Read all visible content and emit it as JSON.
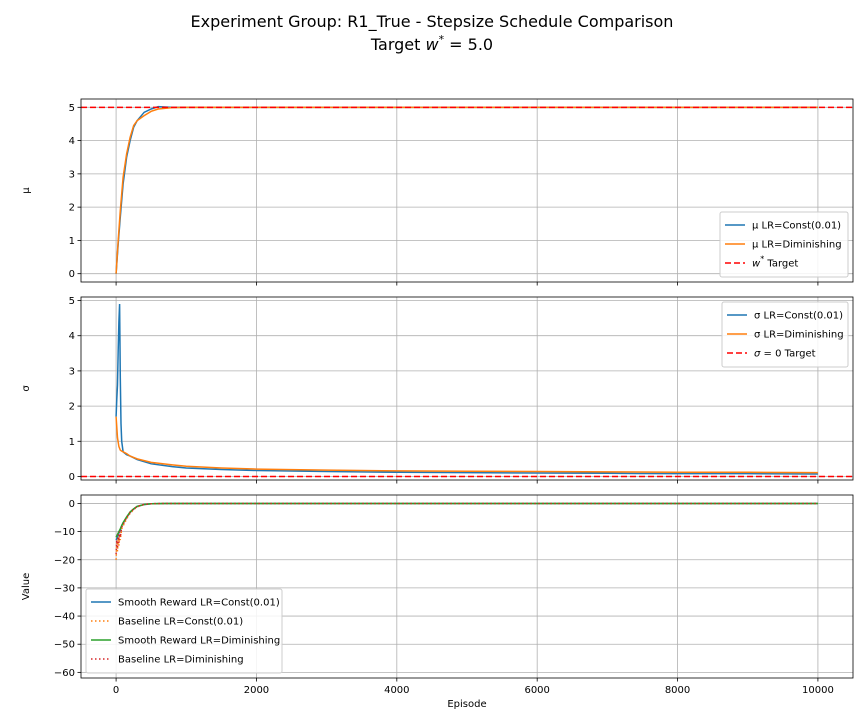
{
  "figure": {
    "title_line1": "Experiment Group: R1_True - Stepsize Schedule Comparison",
    "title_line2_prefix": "Target ",
    "title_line2_symbol": "w",
    "title_line2_sup": "*",
    "title_line2_suffix": " = 5.0"
  },
  "colors": {
    "blue": "#1f77b4",
    "orange": "#ff7f0e",
    "green": "#2ca02c",
    "red": "#d62728",
    "target_red": "#ff0000",
    "grid": "#b0b0b0"
  },
  "chart_data": [
    {
      "type": "line",
      "ylabel": "μ",
      "xlim": [
        -500,
        10500
      ],
      "ylim": [
        -0.25,
        5.25
      ],
      "yticks": [
        0,
        1,
        2,
        3,
        4,
        5
      ],
      "grid": true,
      "legend_position": "lower-right",
      "series": [
        {
          "name": "μ LR=Const(0.01)",
          "color": "blue",
          "style": "solid",
          "x": [
            0,
            30,
            60,
            100,
            150,
            200,
            250,
            300,
            400,
            500,
            600,
            800,
            1000,
            1500,
            2000,
            3000,
            4000,
            5000,
            6000,
            7000,
            8000,
            9000,
            10000
          ],
          "y": [
            0.0,
            0.9,
            1.7,
            2.7,
            3.5,
            4.0,
            4.4,
            4.6,
            4.85,
            4.95,
            5.02,
            5.0,
            5.0,
            5.0,
            5.0,
            5.0,
            5.0,
            5.0,
            5.0,
            5.0,
            5.0,
            5.0,
            5.0
          ]
        },
        {
          "name": "μ LR=Diminishing",
          "color": "orange",
          "style": "solid",
          "x": [
            0,
            30,
            60,
            100,
            150,
            200,
            250,
            300,
            400,
            500,
            600,
            800,
            1000,
            1500,
            2000,
            3000,
            4000,
            5000,
            6000,
            7000,
            8000,
            9000,
            10000
          ],
          "y": [
            0.0,
            1.0,
            1.9,
            2.9,
            3.6,
            4.1,
            4.45,
            4.6,
            4.75,
            4.88,
            4.95,
            4.99,
            5.0,
            5.0,
            5.0,
            5.0,
            5.0,
            5.0,
            5.0,
            5.0,
            5.0,
            5.0,
            5.0
          ]
        },
        {
          "name": "Target",
          "legend_math": "w*",
          "color": "target_red",
          "style": "dashed",
          "hline": 5.0
        }
      ]
    },
    {
      "type": "line",
      "ylabel": "σ",
      "xlim": [
        -500,
        10500
      ],
      "ylim": [
        -0.1,
        5.1
      ],
      "yticks": [
        0,
        1,
        2,
        3,
        4,
        5
      ],
      "grid": true,
      "legend_position": "upper-right",
      "series": [
        {
          "name": "σ LR=Const(0.01)",
          "color": "blue",
          "style": "solid",
          "x": [
            0,
            10,
            20,
            30,
            40,
            50,
            60,
            70,
            80,
            100,
            150,
            200,
            300,
            500,
            800,
            1000,
            1500,
            2000,
            3000,
            4000,
            5000,
            6000,
            7000,
            8000,
            9000,
            10000
          ],
          "y": [
            1.7,
            2.2,
            2.6,
            3.6,
            4.4,
            4.9,
            2.8,
            1.5,
            1.0,
            0.7,
            0.62,
            0.58,
            0.48,
            0.36,
            0.28,
            0.24,
            0.2,
            0.17,
            0.14,
            0.12,
            0.11,
            0.1,
            0.09,
            0.08,
            0.08,
            0.07
          ]
        },
        {
          "name": "σ LR=Diminishing",
          "color": "orange",
          "style": "solid",
          "x": [
            0,
            20,
            40,
            60,
            80,
            100,
            150,
            200,
            300,
            500,
            800,
            1000,
            1500,
            2000,
            3000,
            4000,
            5000,
            6000,
            7000,
            8000,
            9000,
            10000
          ],
          "y": [
            1.7,
            1.1,
            0.85,
            0.75,
            0.72,
            0.7,
            0.65,
            0.58,
            0.5,
            0.4,
            0.33,
            0.29,
            0.24,
            0.21,
            0.18,
            0.16,
            0.15,
            0.14,
            0.13,
            0.12,
            0.12,
            0.11
          ]
        },
        {
          "name": "Target",
          "legend_math": "σ = 0",
          "color": "target_red",
          "style": "dashed",
          "hline": 0
        }
      ]
    },
    {
      "type": "line",
      "ylabel": "Value",
      "xlabel": "Episode",
      "xlim": [
        -500,
        10500
      ],
      "ylim": [
        -62,
        3
      ],
      "yticks": [
        0,
        -10,
        -20,
        -30,
        -40,
        -50,
        -60
      ],
      "xticks": [
        0,
        2000,
        4000,
        6000,
        8000,
        10000
      ],
      "grid": true,
      "legend_position": "lower-left",
      "series": [
        {
          "name": "Smooth Reward LR=Const(0.01)",
          "color": "blue",
          "style": "solid",
          "x": [
            0,
            20,
            40,
            60,
            80,
            100,
            150,
            200,
            250,
            300,
            400,
            500,
            700,
            1000,
            2000,
            4000,
            6000,
            8000,
            10000
          ],
          "y": [
            -13,
            -12,
            -10.5,
            -9.5,
            -8,
            -7,
            -5,
            -3.2,
            -2,
            -1.1,
            -0.4,
            -0.1,
            0,
            0,
            0,
            0,
            0,
            0,
            0
          ]
        },
        {
          "name": "Baseline LR=Const(0.01)",
          "color": "orange",
          "style": "dotted",
          "x": [
            0,
            10,
            20,
            30,
            40,
            50,
            60,
            80,
            100,
            150,
            200,
            250,
            300,
            400,
            500,
            700,
            1000,
            2000,
            4000,
            6000,
            8000,
            10000
          ],
          "y": [
            -20,
            -14,
            -17,
            -12,
            -15,
            -11,
            -13,
            -9,
            -8,
            -5.5,
            -3.5,
            -2.2,
            -1.2,
            -0.4,
            -0.1,
            0,
            0,
            0,
            0,
            0,
            0,
            0
          ]
        },
        {
          "name": "Smooth Reward LR=Diminishing",
          "color": "green",
          "style": "solid",
          "x": [
            0,
            20,
            40,
            60,
            80,
            100,
            150,
            200,
            250,
            300,
            400,
            500,
            700,
            1000,
            2000,
            4000,
            6000,
            8000,
            10000
          ],
          "y": [
            -12,
            -11,
            -10,
            -9,
            -7.8,
            -6.8,
            -4.8,
            -3,
            -1.9,
            -1.0,
            -0.35,
            -0.1,
            0,
            0,
            0,
            0,
            0,
            0,
            0
          ]
        },
        {
          "name": "Baseline LR=Diminishing",
          "color": "red",
          "style": "dotted",
          "x": [
            0,
            10,
            20,
            30,
            40,
            50,
            60,
            80,
            100,
            150,
            200,
            250,
            300,
            400,
            500,
            700,
            1000,
            2000,
            4000,
            6000,
            8000,
            10000
          ],
          "y": [
            -18,
            -13,
            -16,
            -11,
            -14,
            -10,
            -12,
            -8.5,
            -7.5,
            -5,
            -3.2,
            -2,
            -1.1,
            -0.35,
            -0.1,
            0,
            0,
            0,
            0,
            0,
            0,
            0
          ]
        }
      ]
    }
  ]
}
